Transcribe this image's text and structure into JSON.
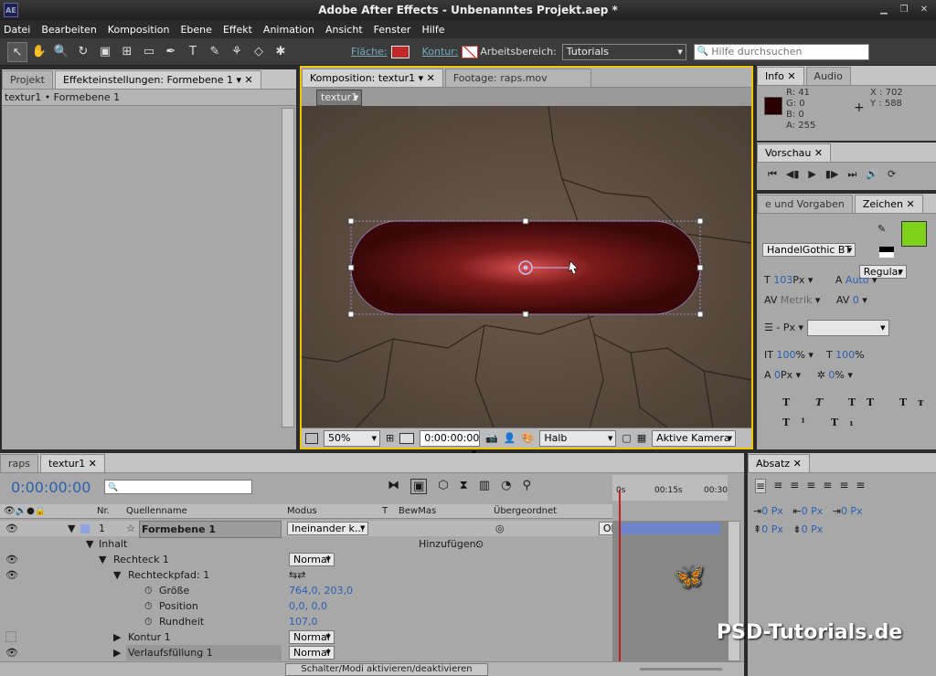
{
  "window": {
    "title": "Adobe After Effects - Unbenanntes Projekt.aep *",
    "logo": "AE"
  },
  "menu": [
    "Datei",
    "Bearbeiten",
    "Komposition",
    "Ebene",
    "Effekt",
    "Animation",
    "Ansicht",
    "Fenster",
    "Hilfe"
  ],
  "toolbar": {
    "flaeche_label": "Fläche:",
    "kontur_label": "Kontur:",
    "arbeitsbereich_label": "Arbeitsbereich:",
    "workspace": "Tutorials",
    "help_placeholder": "Hilfe durchsuchen",
    "fill_color": "#c0282a"
  },
  "left_panel": {
    "tab_projekt": "Projekt",
    "tab_effekt": "Effekteinstellungen: Formebene 1",
    "breadcrumb": "textur1 • Formebene 1"
  },
  "comp_panel": {
    "tab_comp": "Komposition: textur1",
    "tab_footage": "Footage: raps.mov",
    "comp_button": "textur1",
    "zoom": "50%",
    "time": "0:00:00:00",
    "resolution": "Halb",
    "camera": "Aktive Kamera"
  },
  "info_panel": {
    "tab_info": "Info",
    "tab_audio": "Audio",
    "r": "R:  41",
    "g": "G:  0",
    "b": "B:  0",
    "a": "A:  255",
    "x": "X : 702",
    "y": "Y : 588",
    "swatch": "#290000"
  },
  "preview_panel": {
    "tab": "Vorschau"
  },
  "char_panel": {
    "tab_left": "e und Vorgaben",
    "tab_char": "Zeichen",
    "font": "HandelGothic BT",
    "style": "Regular",
    "size": "103",
    "size_unit": "Px",
    "leading": "Auto",
    "kerning": "Metrik",
    "tracking": "0",
    "stroke": "- Px",
    "vscale": "100",
    "hscale": "100",
    "pct": "%",
    "baseline": "0",
    "baseline_unit": "Px",
    "tsume": "0",
    "color_fill": "#7fd11a"
  },
  "para_panel": {
    "tab": "Absatz",
    "values": [
      "0 Px",
      "0 Px",
      "0 Px",
      "0 Px",
      "0 Px"
    ]
  },
  "timeline": {
    "tab_raps": "raps",
    "tab_textur": "textur1",
    "time": "0:00:00:00",
    "col_nr": "Nr.",
    "col_source": "Quellenname",
    "col_mode": "Modus",
    "col_t": "T",
    "col_bewmas": "BewMas",
    "col_parent": "Übergeordnet",
    "ruler": [
      "0s",
      "00:15s",
      "00:30"
    ],
    "layer": {
      "nr": "1",
      "name": "Formebene 1",
      "mode": "Ineinander k...",
      "parent": "Ohne"
    },
    "rows": [
      {
        "label": "Inhalt",
        "extra": "Hinzufügen:"
      },
      {
        "label": "Rechteck 1",
        "mode": "Normal"
      },
      {
        "label": "Rechteckpfad: 1"
      },
      {
        "label": "Größe",
        "value": "764,0, 203,0"
      },
      {
        "label": "Position",
        "value": "0,0, 0,0"
      },
      {
        "label": "Rundheit",
        "value": "107,0"
      },
      {
        "label": "Kontur 1",
        "mode": "Normal"
      },
      {
        "label": "Verlaufsfüllung 1",
        "mode": "Normal"
      }
    ],
    "footer": "Schalter/Modi aktivieren/deaktivieren"
  },
  "watermark": "PSD-Tutorials.de"
}
